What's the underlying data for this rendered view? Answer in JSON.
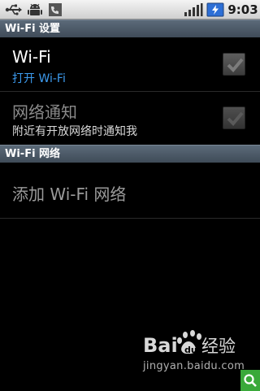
{
  "status_bar": {
    "time": "9:03",
    "icons": [
      "usb-icon",
      "android-debug-icon",
      "missed-call-icon",
      "signal-icon",
      "battery-charging-icon"
    ]
  },
  "sections": {
    "wifi_settings_header": "Wi-Fi 设置",
    "wifi_networks_header": "Wi-Fi 网络"
  },
  "wifi": {
    "title": "Wi-Fi",
    "summary": "打开 Wi-Fi",
    "checked": true
  },
  "network_notification": {
    "title": "网络通知",
    "summary": "附近有开放网络时通知我",
    "checked": true,
    "enabled": false
  },
  "add_network": {
    "title": "添加 Wi-Fi 网络"
  },
  "watermark": {
    "logo_text": "Bai du 经验",
    "url": "jingyan.baidu.com"
  },
  "colors": {
    "header_bg": "#4a5866",
    "summary_blue": "#3d9cf0",
    "fab_green": "#3aa93a"
  }
}
